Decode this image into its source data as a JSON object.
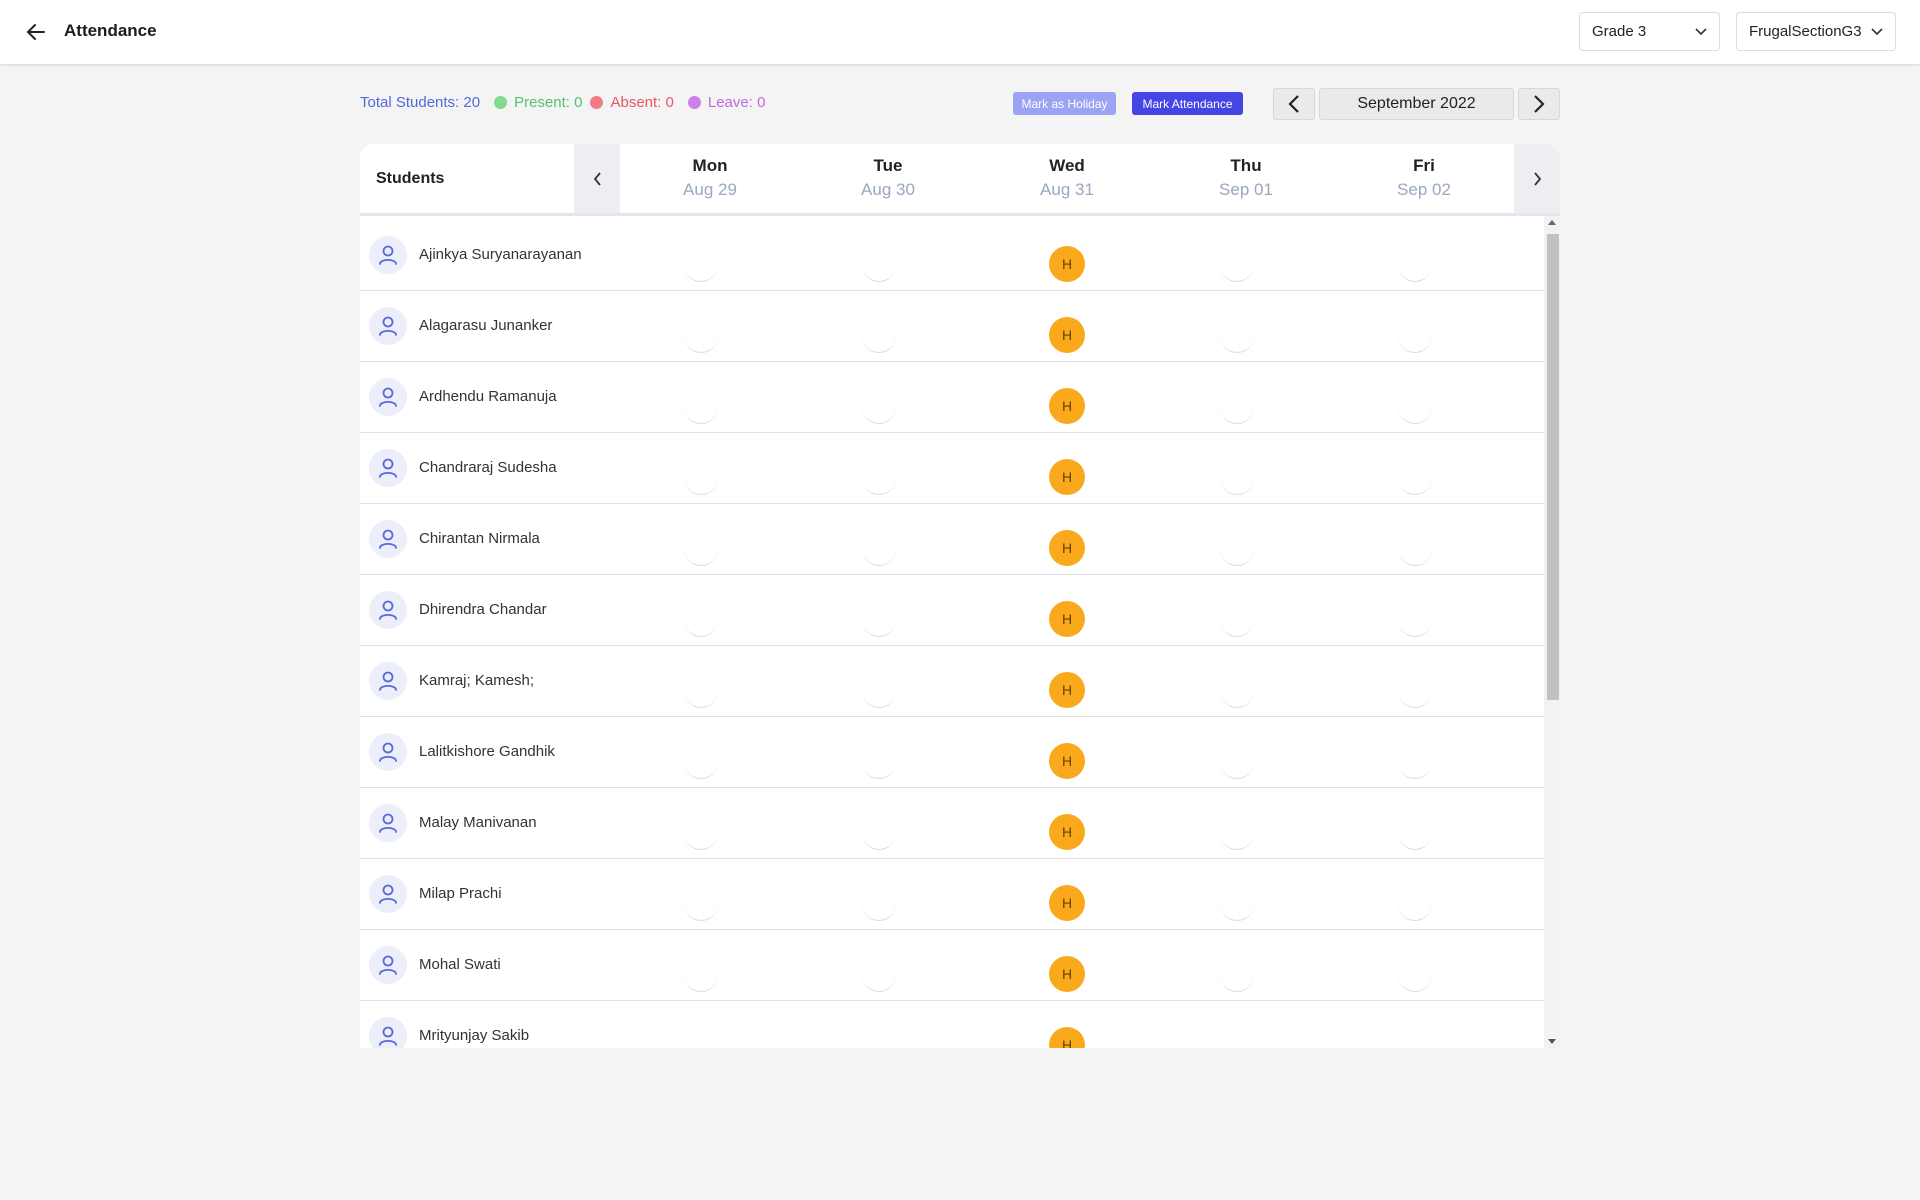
{
  "header": {
    "title": "Attendance",
    "back_icon": "arrow-left-icon",
    "grade_select": "Grade 3",
    "section_select": "FrugalSectionG3"
  },
  "summary": {
    "total": "Total Students: 20",
    "present": "Present: 0",
    "absent": "Absent: 0",
    "leave": "Leave: 0",
    "colors": {
      "present": "#4fc46c",
      "absent": "#e85565",
      "leave": "#c06ad9"
    }
  },
  "actions": {
    "mark_holiday": "Mark as Holiday",
    "mark_attendance": "Mark Attendance"
  },
  "month": {
    "label": "September 2022"
  },
  "table": {
    "students_header": "Students",
    "days": [
      {
        "dow": "Mon",
        "date": "Aug 29"
      },
      {
        "dow": "Tue",
        "date": "Aug 30"
      },
      {
        "dow": "Wed",
        "date": "Aug 31"
      },
      {
        "dow": "Thu",
        "date": "Sep 01"
      },
      {
        "dow": "Fri",
        "date": "Sep 02"
      }
    ],
    "holiday_marker": "H",
    "holiday_day_index": 2,
    "holiday_color": "#f9a91b",
    "students": [
      "Ajinkya Suryanarayanan",
      "Alagarasu Junanker",
      "Ardhendu Ramanuja",
      "Chandraraj Sudesha",
      "Chirantan Nirmala",
      "Dhirendra Chandar",
      "Kamraj; Kamesh;",
      "Lalitkishore Gandhik",
      "Malay Manivanan",
      "Milap Prachi",
      "Mohal Swati",
      "Mrityunjay Sakib"
    ]
  }
}
